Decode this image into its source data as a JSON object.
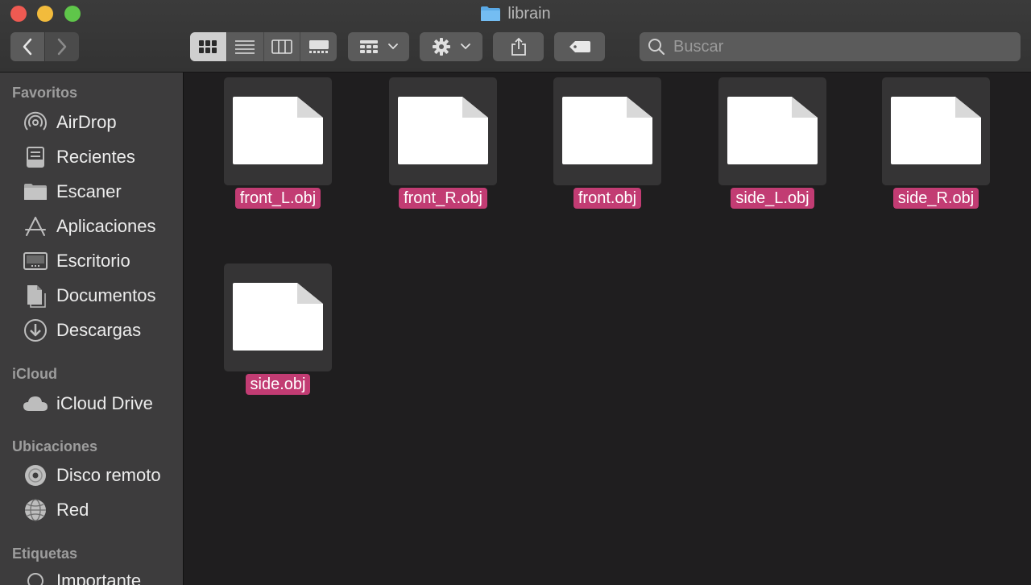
{
  "window": {
    "title": "librain"
  },
  "toolbar": {
    "search_placeholder": "Buscar"
  },
  "sidebar": {
    "favorites_title": "Favoritos",
    "favorites": [
      {
        "label": "AirDrop",
        "icon": "airdrop-icon"
      },
      {
        "label": "Recientes",
        "icon": "recents-icon"
      },
      {
        "label": "Escaner",
        "icon": "folder-icon"
      },
      {
        "label": "Aplicaciones",
        "icon": "applications-icon"
      },
      {
        "label": "Escritorio",
        "icon": "desktop-icon"
      },
      {
        "label": "Documentos",
        "icon": "documents-icon"
      },
      {
        "label": "Descargas",
        "icon": "downloads-icon"
      }
    ],
    "icloud_title": "iCloud",
    "icloud": [
      {
        "label": "iCloud Drive",
        "icon": "cloud-icon"
      }
    ],
    "locations_title": "Ubicaciones",
    "locations": [
      {
        "label": "Disco remoto",
        "icon": "disc-icon"
      },
      {
        "label": "Red",
        "icon": "network-icon"
      }
    ],
    "tags_title": "Etiquetas",
    "tags": [
      {
        "label": "Importante",
        "icon": "tag-circle-icon"
      }
    ]
  },
  "files": [
    {
      "name": "front_L.obj"
    },
    {
      "name": "front_R.obj"
    },
    {
      "name": "front.obj"
    },
    {
      "name": "side_L.obj"
    },
    {
      "name": "side_R.obj"
    },
    {
      "name": "side.obj"
    }
  ],
  "colors": {
    "selection": "#c23c73",
    "close": "#ee5a52",
    "minimize": "#f2bb3c",
    "maximize": "#5fc64a",
    "folder": "#5aa9e6"
  }
}
